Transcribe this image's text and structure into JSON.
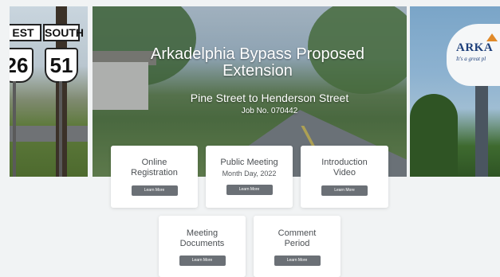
{
  "hero": {
    "title": "Arkadelphia Bypass Proposed Extension",
    "subtitle": "Pine Street to Henderson Street",
    "job_number": "Job No. 070442"
  },
  "photo_left": {
    "sign_left": "EST",
    "sign_right": "SOUTH",
    "shield_left": "26",
    "shield_right": "51"
  },
  "photo_right": {
    "tower_text": "ARKA",
    "tower_tagline": "It's a great pl"
  },
  "cards": [
    {
      "title_line1": "Online",
      "title_line2": "Registration",
      "sub": "",
      "button": "Learn More"
    },
    {
      "title_line1": "Public Meeting",
      "title_line2": "",
      "sub": "Month Day, 2022",
      "button": "Learn More"
    },
    {
      "title_line1": "Introduction",
      "title_line2": "Video",
      "sub": "",
      "button": "Learn More"
    },
    {
      "title_line1": "Meeting",
      "title_line2": "Documents",
      "sub": "",
      "button": "Learn More"
    },
    {
      "title_line1": "Comment",
      "title_line2": "Period",
      "sub": "",
      "button": "Learn More"
    }
  ],
  "colors": {
    "page_background": "#f1f3f4",
    "card_background": "#ffffff",
    "button_background": "#6b7076",
    "button_text": "#ffffff",
    "hero_text": "#ffffff"
  }
}
